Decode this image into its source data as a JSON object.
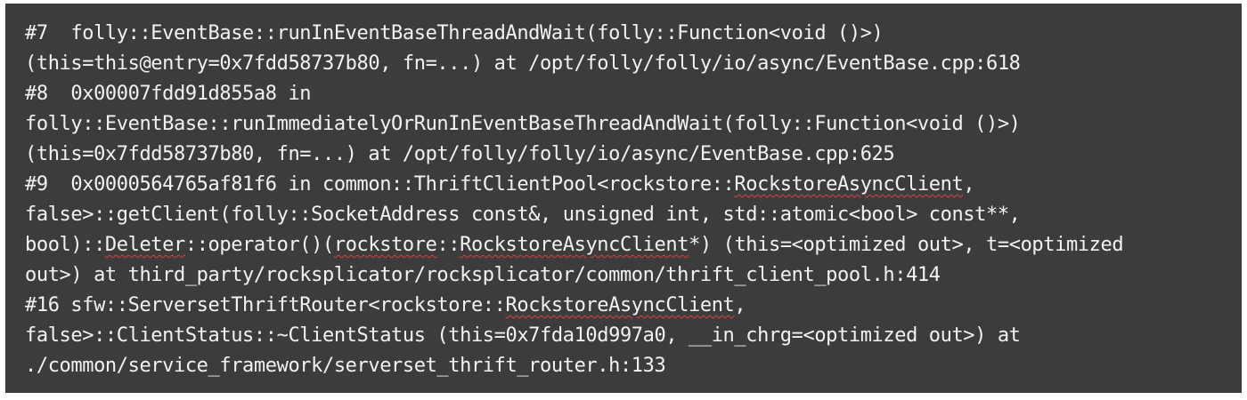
{
  "colors": {
    "panel_background": "#3c3c3c",
    "text": "#f2f2f2",
    "spellcheck_underline": "#e0403a"
  },
  "lines": [
    [
      {
        "text": "#7  folly::EventBase::runInEventBaseThreadAndWait(folly::Function<void ()>)"
      }
    ],
    [
      {
        "text": "(this=this@entry=0x7fdd58737b80, fn=...) at /opt/folly/folly/io/async/EventBase.cpp:618"
      }
    ],
    [
      {
        "text": "#8  0x00007fdd91d855a8 in"
      }
    ],
    [
      {
        "text": "folly::EventBase::runImmediatelyOrRunInEventBaseThreadAndWait(folly::Function<void ()>)"
      }
    ],
    [
      {
        "text": "(this=0x7fdd58737b80, fn=...) at /opt/folly/folly/io/async/EventBase.cpp:625"
      }
    ],
    [
      {
        "text": "#9  0x0000564765af81f6 in common::ThriftClientPool<rockstore::"
      },
      {
        "text": "RockstoreAsyncClient",
        "squiggle": true
      },
      {
        "text": ","
      }
    ],
    [
      {
        "text": "false>::getClient(folly::SocketAddress const&, unsigned int, std::atomic<bool> const**,"
      }
    ],
    [
      {
        "text": "bool)::"
      },
      {
        "text": "Deleter",
        "squiggle": true
      },
      {
        "text": "::operator()("
      },
      {
        "text": "rockstore",
        "squiggle": true
      },
      {
        "text": "::"
      },
      {
        "text": "RockstoreAsyncClient",
        "squiggle": true
      },
      {
        "text": "*) (this=<optimized out>, t=<optimized"
      }
    ],
    [
      {
        "text": "out>) at third_party/rocksplicator/rocksplicator/common/thrift_client_pool.h:414"
      }
    ],
    [
      {
        "text": "#16 sfw::ServersetThriftRouter<rockstore::"
      },
      {
        "text": "RockstoreAsyncClient",
        "squiggle": true
      },
      {
        "text": ","
      }
    ],
    [
      {
        "text": "false>::ClientStatus::~ClientStatus (this=0x7fda10d997a0, __in_chrg=<optimized out>) at"
      }
    ],
    [
      {
        "text": "./common/service_framework/serverset_thrift_router.h:133"
      }
    ]
  ]
}
